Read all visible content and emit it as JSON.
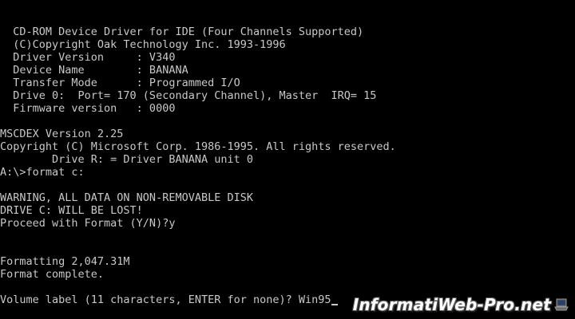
{
  "terminal": {
    "lines": [
      "  CD-ROM Device Driver for IDE (Four Channels Supported)",
      "  (C)Copyright Oak Technology Inc. 1993-1996",
      "  Driver Version     : V340",
      "  Device Name        : BANANA",
      "  Transfer Mode      : Programmed I/O",
      "  Drive 0:  Port= 170 (Secondary Channel), Master  IRQ= 15",
      "  Firmware version   : 0000",
      "",
      "MSCDEX Version 2.25",
      "Copyright (C) Microsoft Corp. 1986-1995. All rights reserved.",
      "        Drive R: = Driver BANANA unit 0",
      "A:\\>format c:",
      "",
      "WARNING, ALL DATA ON NON-REMOVABLE DISK",
      "DRIVE C: WILL BE LOST!",
      "Proceed with Format (Y/N)?y",
      "",
      "",
      "Formatting 2,047.31M",
      "Format complete.",
      "",
      "Volume label (11 characters, ENTER for none)? Win95"
    ]
  },
  "watermark": {
    "text": "InformatiWeb-Pro.net"
  },
  "colors": {
    "background": "#000000",
    "text": "#c8c8c8"
  }
}
